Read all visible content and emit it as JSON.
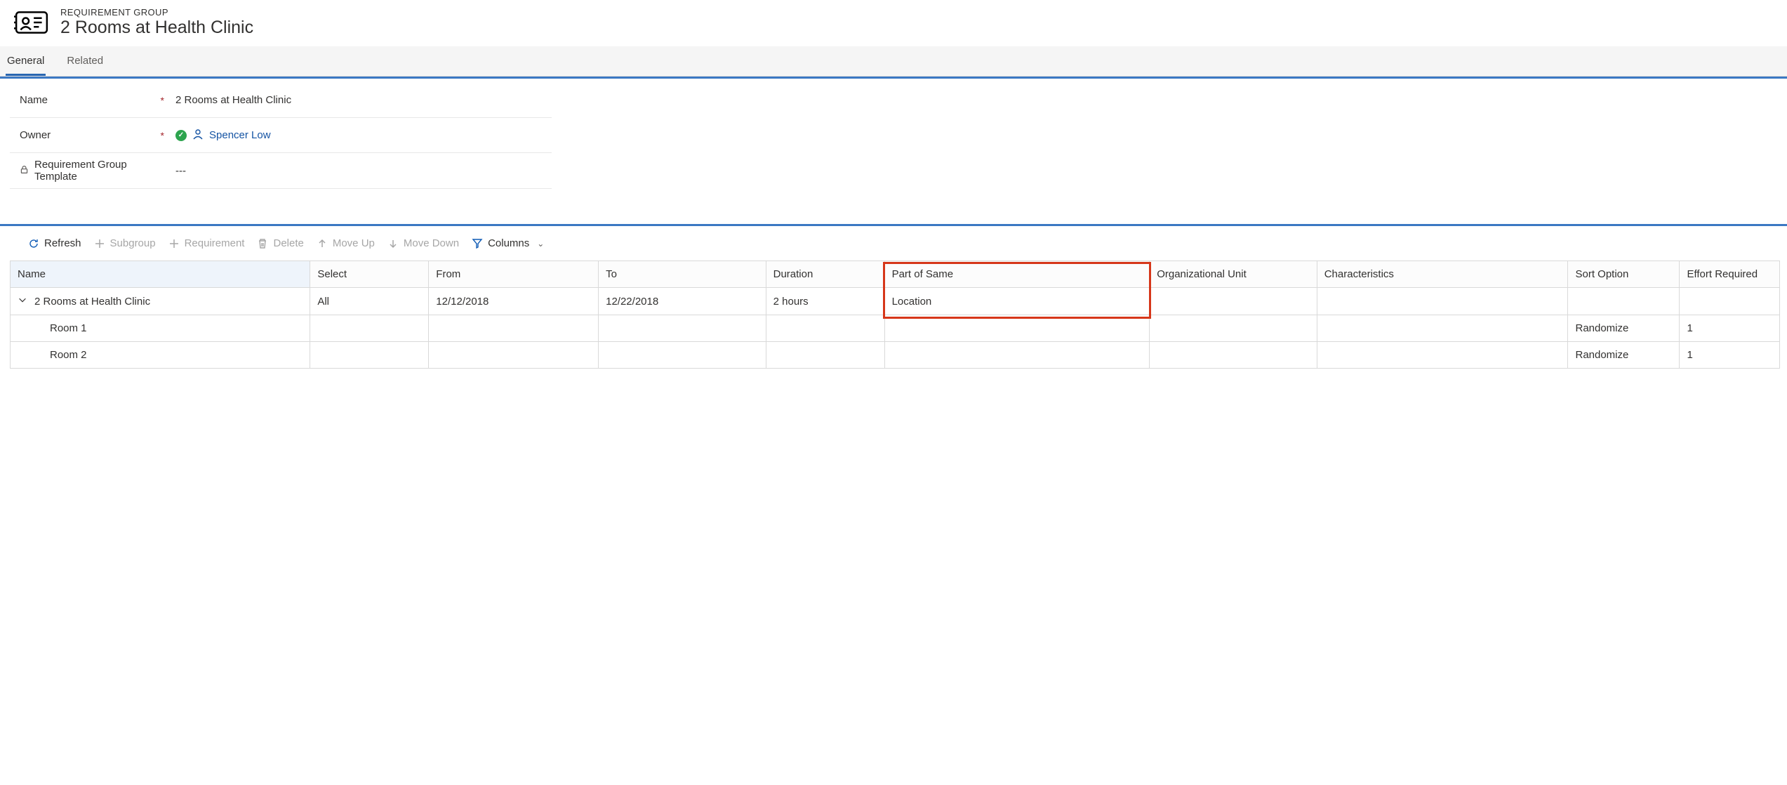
{
  "header": {
    "label": "REQUIREMENT GROUP",
    "title": "2 Rooms at Health Clinic"
  },
  "tabs": {
    "general": "General",
    "related": "Related"
  },
  "form": {
    "name_label": "Name",
    "name_value": "2 Rooms at Health Clinic",
    "owner_label": "Owner",
    "owner_value": "Spencer Low",
    "template_label": "Requirement Group Template",
    "template_value": "---"
  },
  "toolbar": {
    "refresh": "Refresh",
    "subgroup": "Subgroup",
    "requirement": "Requirement",
    "delete": "Delete",
    "moveup": "Move Up",
    "movedown": "Move Down",
    "columns": "Columns"
  },
  "columns": {
    "name": "Name",
    "select": "Select",
    "from": "From",
    "to": "To",
    "duration": "Duration",
    "part": "Part of Same",
    "org": "Organizational Unit",
    "char": "Characteristics",
    "sort": "Sort Option",
    "effort": "Effort Required"
  },
  "rows": [
    {
      "name": "2 Rooms at Health Clinic",
      "select": "All",
      "from": "12/12/2018",
      "to": "12/22/2018",
      "duration": "2 hours",
      "part": "Location",
      "org": "",
      "char": "",
      "sort": "",
      "effort": ""
    },
    {
      "name": "Room 1",
      "select": "",
      "from": "",
      "to": "",
      "duration": "",
      "part": "",
      "org": "",
      "char": "",
      "sort": "Randomize",
      "effort": "1"
    },
    {
      "name": "Room 2",
      "select": "",
      "from": "",
      "to": "",
      "duration": "",
      "part": "",
      "org": "",
      "char": "",
      "sort": "Randomize",
      "effort": "1"
    }
  ]
}
